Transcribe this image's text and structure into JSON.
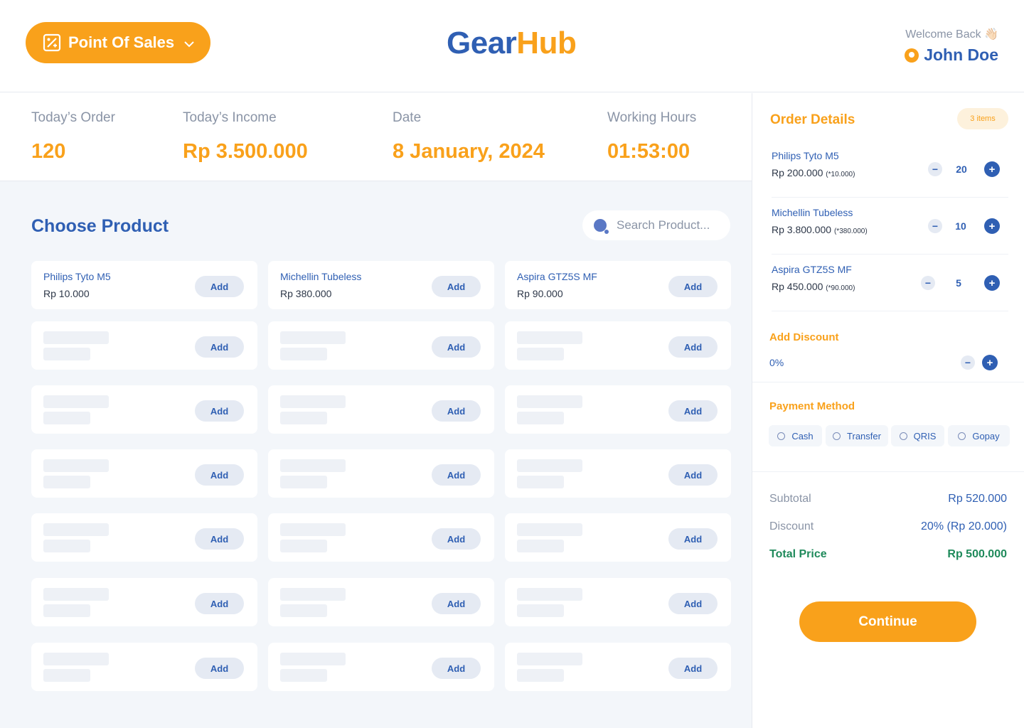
{
  "header": {
    "pos_label": "Point Of Sales",
    "logo_part1": "Gear",
    "logo_part2": "Hub",
    "welcome": "Welcome Back 👋🏻",
    "user_name": "John Doe"
  },
  "stats": [
    {
      "label": "Today’s Order",
      "value": "120"
    },
    {
      "label": "Today’s Income",
      "value": "Rp 3.500.000"
    },
    {
      "label": "Date",
      "value": "8 January, 2024"
    },
    {
      "label": "Working Hours",
      "value": "01:53:00"
    }
  ],
  "products": {
    "title": "Choose Product",
    "search_placeholder": "Search Product...",
    "add_label": "Add",
    "items": [
      {
        "name": "Philips Tyto M5",
        "price": "Rp 10.000"
      },
      {
        "name": "Michellin Tubeless",
        "price": "Rp 380.000"
      },
      {
        "name": "Aspira GTZ5S MF",
        "price": "Rp 90.000"
      }
    ]
  },
  "order": {
    "title": "Order Details",
    "badge": "3 items",
    "items": [
      {
        "name": "Philips Tyto M5",
        "total": "Rp 200.000",
        "unit": "(*10.000)",
        "qty": "20"
      },
      {
        "name": "Michellin Tubeless",
        "total": "Rp 3.800.000",
        "unit": "(*380.000)",
        "qty": "10"
      },
      {
        "name": "Aspira GTZ5S MF",
        "total": "Rp 450.000",
        "unit": "(*90.000)",
        "qty": "5"
      }
    ],
    "discount_title": "Add Discount",
    "discount_value": "0%",
    "payment_title": "Payment Method",
    "payment_options": [
      "Cash",
      "Transfer",
      "QRIS",
      "Gopay"
    ],
    "subtotal_label": "Subtotal",
    "subtotal_value": "Rp 520.000",
    "discount_label": "Discount",
    "discount_amount": "20% (Rp 20.000)",
    "total_label": "Total Price",
    "total_value": "Rp 500.000",
    "continue_label": "Continue"
  },
  "colors": {
    "accent": "#f9a11b",
    "primary": "#2f5fb3",
    "success": "#1f8a5b"
  }
}
